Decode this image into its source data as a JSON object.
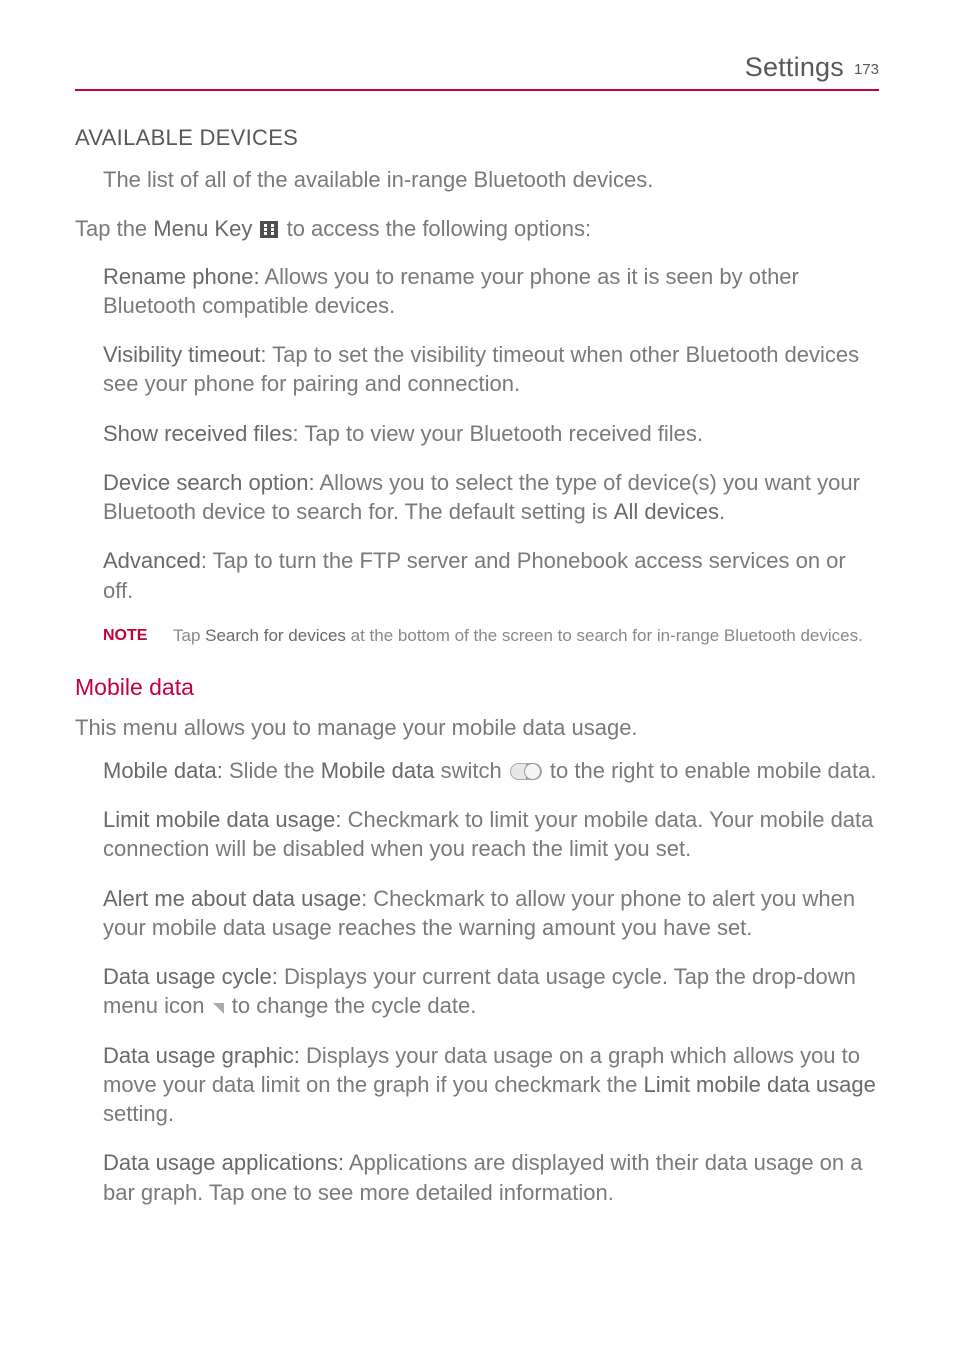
{
  "header": {
    "title": "Settings",
    "page_number": "173"
  },
  "section_available_devices": {
    "heading": "AVAILABLE DEVICES",
    "desc": "The list of all of the available in-range Bluetooth devices."
  },
  "tap_line": {
    "pre": "Tap the ",
    "menu_key_bold": "Menu Key",
    "post": " to access the following options:"
  },
  "options": {
    "rename": {
      "title": "Rename phone:",
      "text": " Allows you to rename your phone as it is seen by other Bluetooth compatible devices."
    },
    "visibility": {
      "title": "Visibility timeout",
      "text": ": Tap to set the visibility timeout when other Bluetooth devices see your phone for pairing and connection."
    },
    "show_received": {
      "title": "Show received files",
      "text": ": Tap to view your Bluetooth received files."
    },
    "device_search": {
      "title": "Device search option:",
      "text_pre": " Allows you to select the type of device(s) you want your Bluetooth device to search for. The default setting is ",
      "all_devices": "All devices",
      "text_post": "."
    },
    "advanced": {
      "title": "Advanced",
      "text": ": Tap to turn the FTP server and Phonebook access services on or off."
    }
  },
  "note": {
    "label": "NOTE",
    "pre": "Tap ",
    "bold": "Search for devices",
    "post": " at the bottom of the screen to search for in-range Bluetooth devices."
  },
  "mobile_data": {
    "heading": "Mobile data",
    "intro": "This menu allows you to manage your mobile data usage.",
    "items": {
      "mobile_data_switch": {
        "title": "Mobile data:",
        "pre": " Slide the ",
        "bold_mid": "Mobile data",
        "mid": " switch ",
        "post": " to the right to enable mobile data."
      },
      "limit": {
        "title": "Limit mobile data usage:",
        "text": " Checkmark to limit your mobile data. Your mobile data connection will be disabled when you reach the limit you set."
      },
      "alert": {
        "title": "Alert me about data usage",
        "text": ": Checkmark to allow your phone to alert you when your mobile data usage reaches the warning amount you have set."
      },
      "cycle": {
        "title": "Data usage cycle:",
        "pre": " Displays your current data usage cycle. Tap the drop-down menu icon ",
        "post": " to change the cycle date."
      },
      "graphic": {
        "title": "Data usage graphic:",
        "pre": " Displays your data usage on a graph which allows you to move your data limit on the graph if you checkmark the ",
        "bold_mid": "Limit mobile data usage",
        "post": " setting."
      },
      "apps": {
        "title": "Data usage applications:",
        "text": " Applications are displayed with their data usage on a bar graph. Tap one to see more detailed information."
      }
    }
  }
}
